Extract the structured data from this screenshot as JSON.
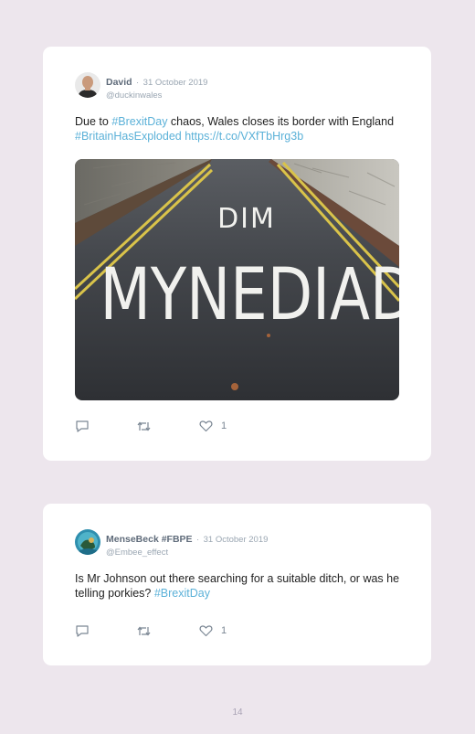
{
  "tweets": [
    {
      "name": "David",
      "separator": "·",
      "date": "31 October 2019",
      "handle": "@duckinwales",
      "text_parts": [
        "Due to ",
        "#BrexitDay",
        " chaos, Wales closes its border with England ",
        "#BritainHasExploded",
        " ",
        "https://t.co/VXfTbHrg3b"
      ],
      "image": {
        "road_text_top": "DIM",
        "road_text_bottom": "MYNEDIAD"
      },
      "likes": "1"
    },
    {
      "name": "MenseBeck #FBPE",
      "separator": "·",
      "date": "31 October 2019",
      "handle": "@Embee_effect",
      "text_parts": [
        "Is Mr Johnson out there searching for a suitable ditch, or was he telling porkies? ",
        "#BrexitDay"
      ],
      "likes": "1"
    }
  ],
  "page_number": "14",
  "icons": [
    "reply-icon",
    "retweet-icon",
    "heart-icon"
  ],
  "colors": {
    "background": "#ede6ed",
    "card": "#ffffff",
    "link": "#5bb1d8",
    "muted": "#9aa6b2"
  }
}
